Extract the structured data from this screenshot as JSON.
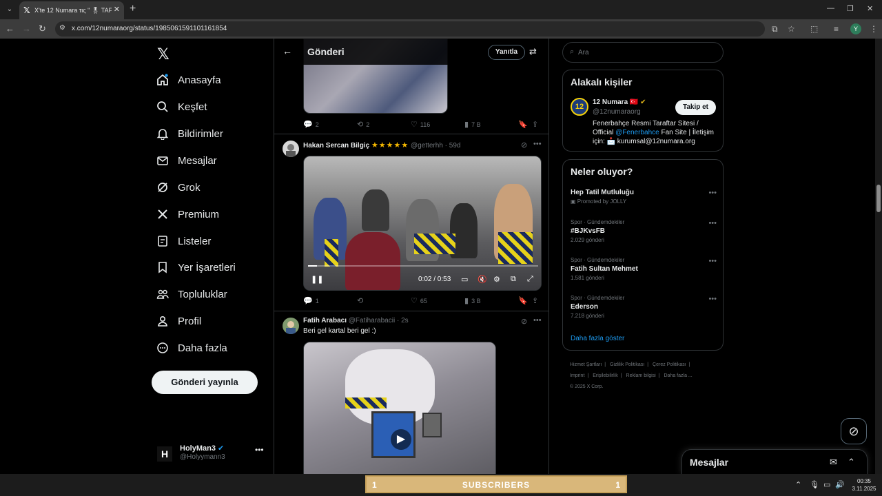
{
  "browser": {
    "tab_title": "X'te 12 Numara τις \" 🎖 TAF",
    "url": "x.com/12numaraorg/status/1985061591101161854",
    "profile_initial": "Y"
  },
  "nav": {
    "items": [
      {
        "label": "Anasayfa",
        "icon": "home-icon"
      },
      {
        "label": "Keşfet",
        "icon": "search-icon"
      },
      {
        "label": "Bildirimler",
        "icon": "bell-icon"
      },
      {
        "label": "Mesajlar",
        "icon": "mail-icon"
      },
      {
        "label": "Grok",
        "icon": "grok-icon"
      },
      {
        "label": "Premium",
        "icon": "x-icon"
      },
      {
        "label": "Listeler",
        "icon": "list-icon"
      },
      {
        "label": "Yer İşaretleri",
        "icon": "bookmark-icon"
      },
      {
        "label": "Topluluklar",
        "icon": "communities-icon"
      },
      {
        "label": "Profil",
        "icon": "profile-icon"
      },
      {
        "label": "Daha fazla",
        "icon": "more-circle-icon"
      }
    ],
    "post_button": "Gönderi yayınla",
    "account": {
      "name": "HolyMan3",
      "handle": "@Holyymann3",
      "avatar_letter": "H"
    }
  },
  "main": {
    "title": "Gönderi",
    "reply_button": "Yanıtla",
    "first_actions": {
      "replies": "2",
      "reposts": "2",
      "likes": "116",
      "views": "7 B"
    },
    "tweets": [
      {
        "name": "Hakan Sercan Bilgiç",
        "stars": "★★★★★",
        "handle": "@getterhh",
        "time": "59d",
        "video_time": "0:02 / 0:53",
        "video_progress": 0.04,
        "replies": "1",
        "reposts": "",
        "likes": "65",
        "views": "3 B"
      },
      {
        "name": "Fatih Arabacı",
        "handle": "@Fatiharabacii",
        "time": "2s",
        "text": "Beri gel kartal beri gel :)"
      }
    ]
  },
  "search": {
    "placeholder": "Ara"
  },
  "related": {
    "title": "Alakalı kişiler",
    "name": "12 Numara 🇹🇷",
    "handle": "@12numaraorg",
    "avatar_text": "12",
    "follow_button": "Takip et",
    "bio_part1": "Fenerbahçe Resmi Taraftar Sitesi / Official ",
    "bio_link": "@Fenerbahce",
    "bio_part2": " Fan Site | İletişim için: 📩 kurumsal@12numara.org"
  },
  "trends": {
    "title": "Neler oluyor?",
    "items": [
      {
        "category": "",
        "name": "Hep Tatil Mutluluğu",
        "count": "Promoted by JOLLY"
      },
      {
        "category": "Spor · Gündemdekiler",
        "name": "#BJKvsFB",
        "count": "2.029 gönderi"
      },
      {
        "category": "Spor · Gündemdekiler",
        "name": "Fatih Sultan Mehmet",
        "count": "1.581 gönderi"
      },
      {
        "category": "Spor · Gündemdekiler",
        "name": "Ederson",
        "count": "7.218 gönderi"
      }
    ],
    "show_more": "Daha fazla göster"
  },
  "footer": {
    "links": [
      "Hizmet Şartları",
      "|",
      "Gizlilik Politikası",
      "|",
      "Çerez Politikası",
      "|",
      "Imprint",
      "|",
      "Erişilebilirlik",
      "|",
      "Reklam bilgisi",
      "|",
      "Daha fazla ..."
    ],
    "copyright": "© 2025 X Corp."
  },
  "messages_dock": {
    "title": "Mesajlar"
  },
  "taskbar": {
    "banner_left": "1",
    "banner_title": "SUBSCRIBERS",
    "banner_right": "1",
    "time": "00:35",
    "date": "3.11.2025"
  }
}
